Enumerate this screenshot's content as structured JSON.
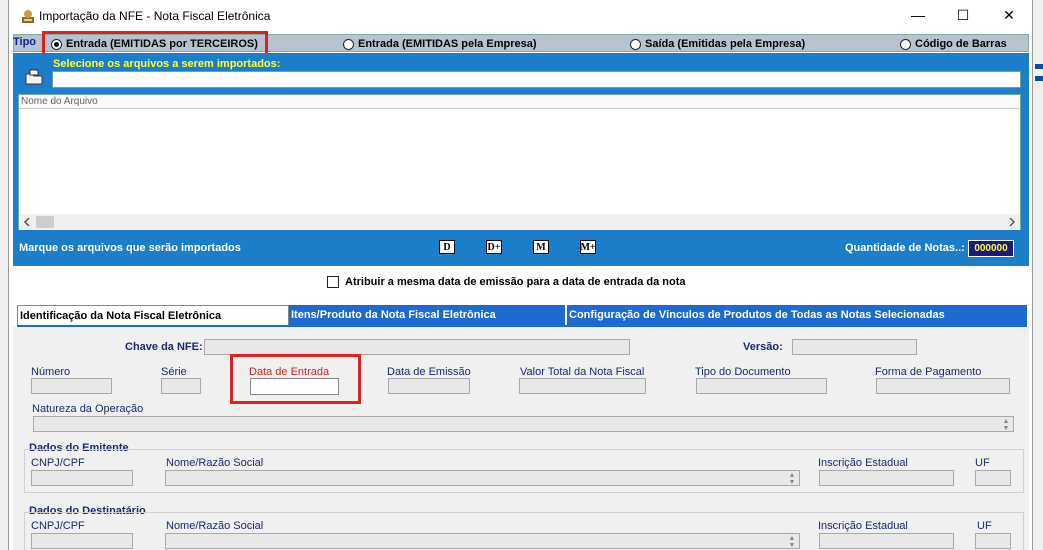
{
  "window": {
    "title": "Importação da NFE - Nota Fiscal Eletrônica",
    "minimize": "—",
    "maximize": "☐",
    "close": "✕"
  },
  "tipo": {
    "label": "Tipo",
    "options": [
      {
        "label": "Entrada (EMITIDAS por TERCEIROS)",
        "selected": true
      },
      {
        "label": "Entrada (EMITIDAS pela Empresa)",
        "selected": false
      },
      {
        "label": "Saída (Emitidas pela Empresa)",
        "selected": false
      },
      {
        "label": "Código de Barras",
        "selected": false
      }
    ]
  },
  "files": {
    "select_label": "Selecione os arquivos a serem importados:",
    "path_value": "",
    "column_header": "Nome do Arquivo",
    "mark_label": "Marque os arquivos que serão importados",
    "buttons": [
      "D",
      "D+",
      "M",
      "M+"
    ],
    "quantity_label": "Quantidade de Notas..:",
    "quantity_value": "000000"
  },
  "same_date_checkbox": {
    "label": "Atribuir a mesma data de emissão para a data de entrada da nota",
    "checked": false
  },
  "tabs": [
    "Identificação da Nota Fiscal Eletrônica",
    "Itens/Produto da Nota Fiscal Eletrônica",
    "Configuração de Vínculos de Produtos de Todas as Notas Selecionadas"
  ],
  "nfe": {
    "chave_label": "Chave da NFE:",
    "versao_label": "Versão:",
    "numero_label": "Número",
    "serie_label": "Série",
    "data_entrada_label": "Data de Entrada",
    "data_emissao_label": "Data de Emissão",
    "valor_total_label": "Valor Total da Nota Fiscal",
    "tipo_documento_label": "Tipo do Documento",
    "forma_pagamento_label": "Forma de Pagamento",
    "natureza_label": "Natureza da Operação"
  },
  "emitente": {
    "title": "Dados do Emitente",
    "cnpj_label": "CNPJ/CPF",
    "nome_label": "Nome/Razão Social",
    "ie_label": "Inscrição Estadual",
    "uf_label": "UF"
  },
  "destinatario": {
    "title": "Dados do Destinatário",
    "cnpj_label": "CNPJ/CPF",
    "nome_label": "Nome/Razão Social",
    "ie_label": "Inscrição Estadual",
    "uf_label": "UF"
  },
  "colors": {
    "panel_blue": "#1c7ec9",
    "tab_blue": "#1d6bd0",
    "highlight_red": "#e02020",
    "label_yellow": "#ffff33"
  }
}
